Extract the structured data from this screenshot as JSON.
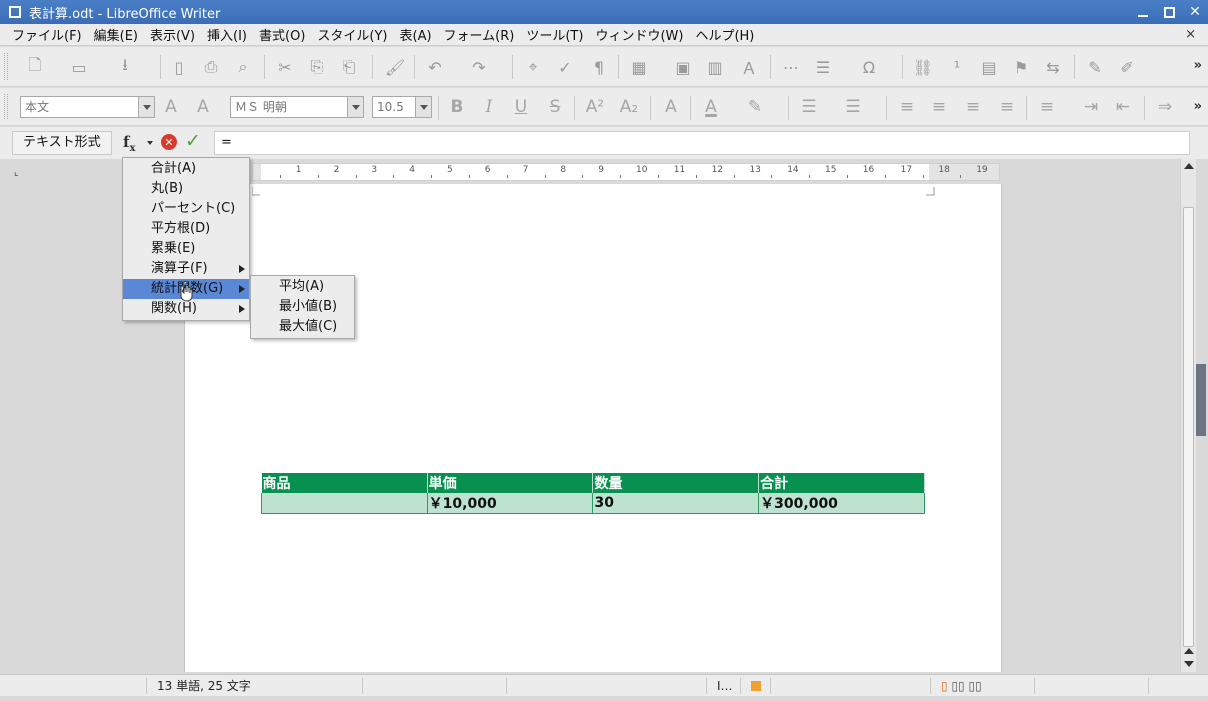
{
  "window": {
    "title": "表計算.odt - LibreOffice Writer"
  },
  "menubar": {
    "items": [
      {
        "label": "ファイル(F)"
      },
      {
        "label": "編集(E)"
      },
      {
        "label": "表示(V)"
      },
      {
        "label": "挿入(I)"
      },
      {
        "label": "書式(O)"
      },
      {
        "label": "スタイル(Y)"
      },
      {
        "label": "表(A)"
      },
      {
        "label": "フォーム(R)"
      },
      {
        "label": "ツール(T)"
      },
      {
        "label": "ウィンドウ(W)"
      },
      {
        "label": "ヘルプ(H)"
      }
    ],
    "close_glyph": "×"
  },
  "format_toolbar": {
    "paragraph_style": "本文",
    "font_name": "ＭＳ 明朝",
    "font_size": "10.5"
  },
  "formula_bar": {
    "name_box": "テキスト形式",
    "formula": "="
  },
  "formula_menu": {
    "items": [
      {
        "label": "合計(A)",
        "has_submenu": false
      },
      {
        "label": "丸(B)",
        "has_submenu": false
      },
      {
        "label": "パーセント(C)",
        "has_submenu": false
      },
      {
        "label": "平方根(D)",
        "has_submenu": false
      },
      {
        "label": "累乗(E)",
        "has_submenu": false
      },
      {
        "label": "演算子(F)",
        "has_submenu": true
      },
      {
        "label": "統計関数(G)",
        "has_submenu": true,
        "active": true
      },
      {
        "label": "関数(H)",
        "has_submenu": true
      }
    ]
  },
  "stat_submenu": {
    "items": [
      {
        "label": "平均(A)"
      },
      {
        "label": "最小値(B)"
      },
      {
        "label": "最大値(C)"
      }
    ]
  },
  "ruler": {
    "labels": [
      "1",
      "2",
      "3",
      "4",
      "5",
      "6",
      "7",
      "8",
      "9",
      "10",
      "11",
      "12",
      "13",
      "14",
      "15",
      "16",
      "17",
      "18",
      "19"
    ]
  },
  "table": {
    "header": [
      "商品",
      "単価",
      "数量",
      "合計"
    ],
    "rows": [
      [
        "",
        "￥10,000",
        "30",
        "￥300,000"
      ]
    ],
    "header_color": "#079050",
    "row_color": "#bde3d0"
  },
  "statusbar": {
    "word_count": "13 単語, 25 文字"
  }
}
